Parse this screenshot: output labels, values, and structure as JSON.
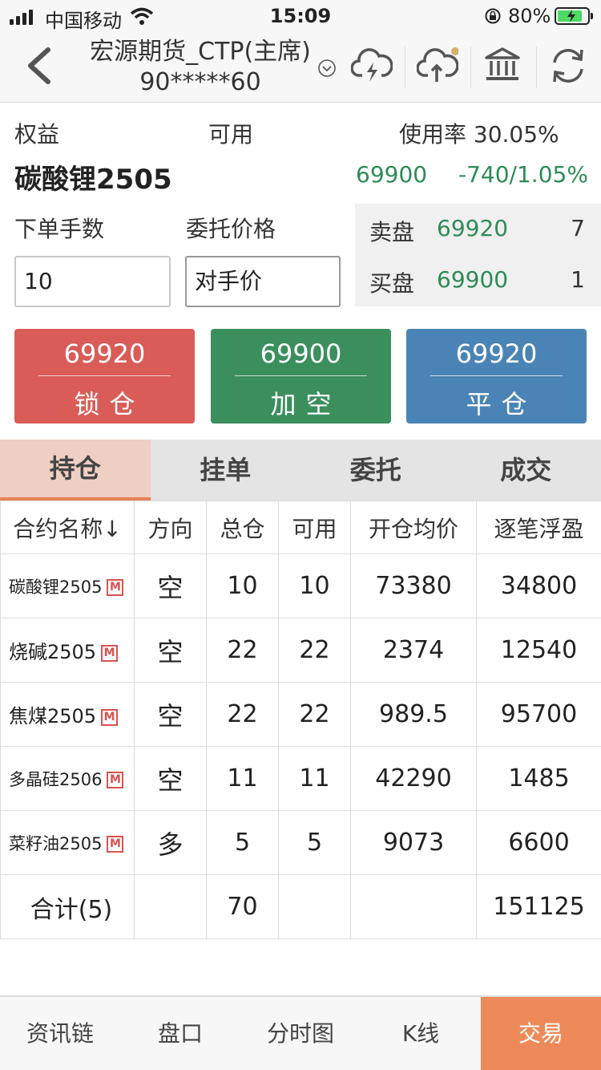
{
  "status_bar": {
    "carrier": "中国移动",
    "time": "15:09",
    "battery_pct": "80%",
    "battery_level": 0.8
  },
  "nav": {
    "title": "宏源期货_CTP(主席)",
    "account": "90*****60",
    "icons": [
      "back-icon",
      "dropdown-icon",
      "cloud-lightning-icon",
      "cloud-upload-icon",
      "bank-icon",
      "refresh-icon"
    ],
    "badge_color": "#d4b06a"
  },
  "account": {
    "equity_label": "权益",
    "available_label": "可用",
    "usage_label": "使用率 30.05%"
  },
  "instrument": {
    "name": "碳酸锂2505",
    "last": "69900",
    "change": "-740/1.05%"
  },
  "order": {
    "qty_label": "下单手数",
    "price_label": "委托价格",
    "qty_value": "10",
    "price_value": "对手价"
  },
  "book": {
    "ask_label": "卖盘",
    "ask_price": "69920",
    "ask_vol": "7",
    "bid_label": "买盘",
    "bid_price": "69900",
    "bid_vol": "1"
  },
  "actions": [
    {
      "price": "69920",
      "label": "锁仓",
      "color": "#d9534f"
    },
    {
      "price": "69900",
      "label": "加空",
      "color": "#3a8f5d"
    },
    {
      "price": "69920",
      "label": "平仓",
      "color": "#4a84b6"
    }
  ],
  "tabs": [
    "持仓",
    "挂单",
    "委托",
    "成交"
  ],
  "table": {
    "headers": [
      "合约名称↓",
      "方向",
      "总仓",
      "可用",
      "开仓均价",
      "逐笔浮盈"
    ],
    "rows": [
      {
        "name": "碳酸锂2505",
        "badge": "M",
        "dir": "空",
        "total": "10",
        "avail": "10",
        "avg": "73380",
        "pl": "34800"
      },
      {
        "name": "烧碱2505",
        "badge": "M",
        "dir": "空",
        "total": "22",
        "avail": "22",
        "avg": "2374",
        "pl": "12540"
      },
      {
        "name": "焦煤2505",
        "badge": "M",
        "dir": "空",
        "total": "22",
        "avail": "22",
        "avg": "989.5",
        "pl": "95700"
      },
      {
        "name": "多晶硅2506",
        "badge": "M",
        "dir": "空",
        "total": "11",
        "avail": "11",
        "avg": "42290",
        "pl": "1485"
      },
      {
        "name": "菜籽油2505",
        "badge": "M",
        "dir": "多",
        "total": "5",
        "avail": "5",
        "avg": "9073",
        "pl": "6600"
      }
    ],
    "total": {
      "name": "合计(5)",
      "total": "70",
      "pl": "151125"
    }
  },
  "bottom_nav": [
    "资讯链",
    "盘口",
    "分时图",
    "K线",
    "交易"
  ],
  "colors": {
    "accent": "#ee8a5a",
    "up": "#d9534f",
    "down": "#2e8b57"
  }
}
